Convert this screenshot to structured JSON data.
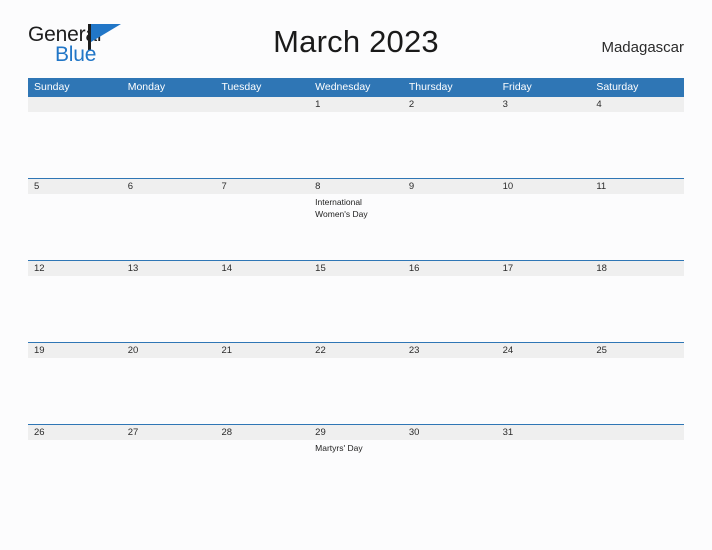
{
  "brand": {
    "name_part1": "General",
    "name_part2": "Blue",
    "flag_icon": "flag-icon",
    "accent_color": "#2176c7"
  },
  "header": {
    "month_title": "March 2023",
    "locale": "Madagascar"
  },
  "theme": {
    "header_blue": "#2f76b5",
    "date_band_gray": "#efefef",
    "page_background": "#fcfcfd",
    "text_color": "#2b2b2b"
  },
  "calendar": {
    "month": "March",
    "year": "2023",
    "weekday_headers": [
      "Sunday",
      "Monday",
      "Tuesday",
      "Wednesday",
      "Thursday",
      "Friday",
      "Saturday"
    ],
    "weeks": [
      {
        "days": [
          {
            "number": "",
            "event": ""
          },
          {
            "number": "",
            "event": ""
          },
          {
            "number": "",
            "event": ""
          },
          {
            "number": "1",
            "event": ""
          },
          {
            "number": "2",
            "event": ""
          },
          {
            "number": "3",
            "event": ""
          },
          {
            "number": "4",
            "event": ""
          }
        ]
      },
      {
        "days": [
          {
            "number": "5",
            "event": ""
          },
          {
            "number": "6",
            "event": ""
          },
          {
            "number": "7",
            "event": ""
          },
          {
            "number": "8",
            "event": "International Women's Day"
          },
          {
            "number": "9",
            "event": ""
          },
          {
            "number": "10",
            "event": ""
          },
          {
            "number": "11",
            "event": ""
          }
        ]
      },
      {
        "days": [
          {
            "number": "12",
            "event": ""
          },
          {
            "number": "13",
            "event": ""
          },
          {
            "number": "14",
            "event": ""
          },
          {
            "number": "15",
            "event": ""
          },
          {
            "number": "16",
            "event": ""
          },
          {
            "number": "17",
            "event": ""
          },
          {
            "number": "18",
            "event": ""
          }
        ]
      },
      {
        "days": [
          {
            "number": "19",
            "event": ""
          },
          {
            "number": "20",
            "event": ""
          },
          {
            "number": "21",
            "event": ""
          },
          {
            "number": "22",
            "event": ""
          },
          {
            "number": "23",
            "event": ""
          },
          {
            "number": "24",
            "event": ""
          },
          {
            "number": "25",
            "event": ""
          }
        ]
      },
      {
        "days": [
          {
            "number": "26",
            "event": ""
          },
          {
            "number": "27",
            "event": ""
          },
          {
            "number": "28",
            "event": ""
          },
          {
            "number": "29",
            "event": "Martyrs' Day"
          },
          {
            "number": "30",
            "event": ""
          },
          {
            "number": "31",
            "event": ""
          },
          {
            "number": "",
            "event": ""
          }
        ]
      }
    ]
  }
}
